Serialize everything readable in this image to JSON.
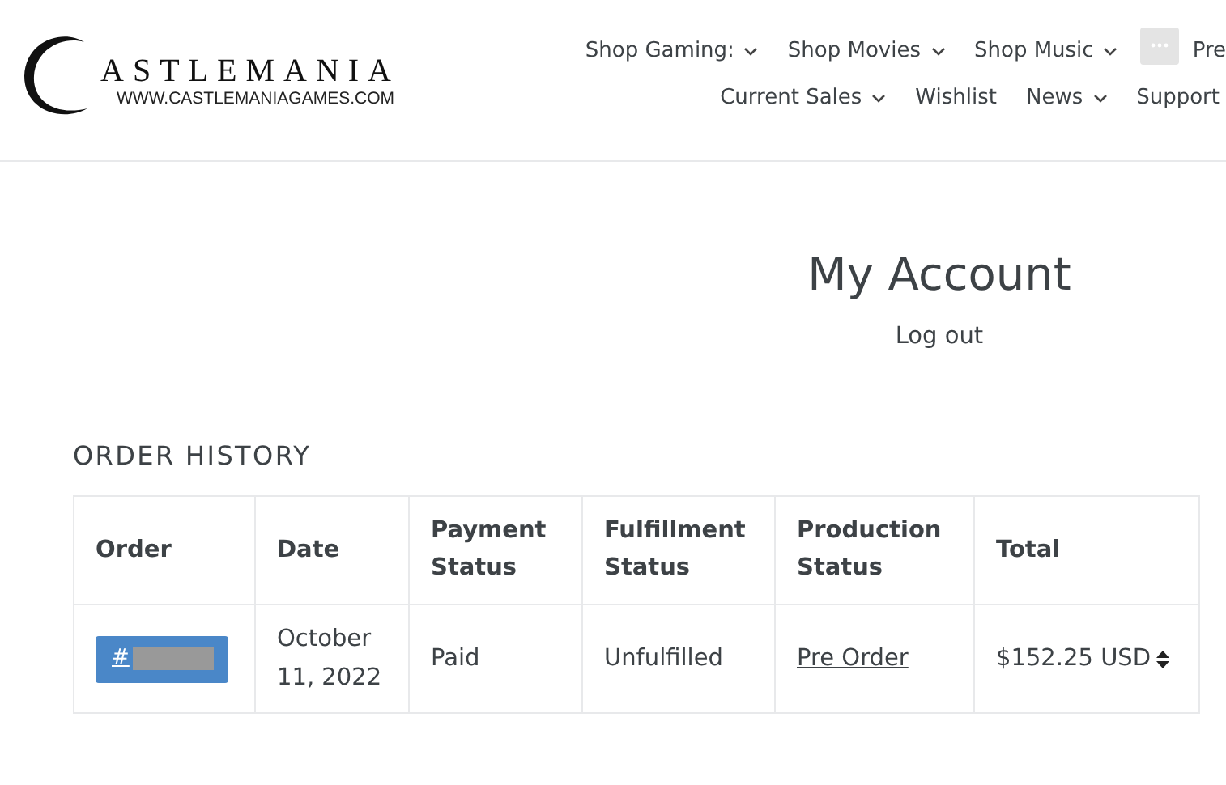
{
  "logo": {
    "name": "ASTLEMANIA",
    "url": "WWW.CASTLEMANIAGAMES.COM"
  },
  "nav_rows": [
    [
      {
        "label": "Shop Gaming:",
        "dropdown": true
      },
      {
        "label": "Shop Movies",
        "dropdown": true
      },
      {
        "label": "Shop Music",
        "dropdown": true
      },
      {
        "label": "Pre",
        "dropdown": false
      }
    ],
    [
      {
        "label": "Current Sales",
        "dropdown": true
      },
      {
        "label": "Wishlist",
        "dropdown": false
      },
      {
        "label": "News",
        "dropdown": true
      },
      {
        "label": "Support",
        "dropdown": false
      }
    ]
  ],
  "page_title": "My Account",
  "logout": "Log out",
  "section_title": "ORDER HISTORY",
  "table": {
    "columns": [
      "Order",
      "Date",
      "Payment Status",
      "Fulfillment Status",
      "Production Status",
      "Total"
    ],
    "rows": [
      {
        "order": "#",
        "date": "October 11, 2022",
        "payment": "Paid",
        "fulfillment": "Unfulfilled",
        "production": "Pre Order",
        "total": "$152.25 USD"
      }
    ]
  }
}
